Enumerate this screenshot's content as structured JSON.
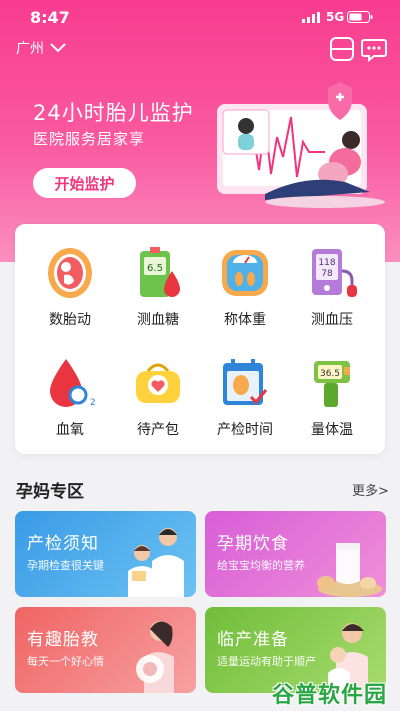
{
  "status_bar": {
    "time": "8:47",
    "network": "5G"
  },
  "location": {
    "city": "广州"
  },
  "banner": {
    "title": "24小时胎儿监护",
    "subtitle": "医院服务居家享",
    "button_label": "开始监护"
  },
  "services": [
    {
      "label": "数胎动",
      "icon": "fetus-icon"
    },
    {
      "label": "测血糖",
      "icon": "glucose-meter-icon"
    },
    {
      "label": "称体重",
      "icon": "scale-icon"
    },
    {
      "label": "测血压",
      "icon": "blood-pressure-icon"
    },
    {
      "label": "血氧",
      "icon": "blood-oxygen-icon"
    },
    {
      "label": "待产包",
      "icon": "maternity-bag-icon"
    },
    {
      "label": "产检时间",
      "icon": "calendar-icon"
    },
    {
      "label": "量体温",
      "icon": "thermometer-icon"
    }
  ],
  "section": {
    "title": "孕妈专区",
    "more": "更多>"
  },
  "tiles": [
    {
      "title": "产检须知",
      "subtitle": "孕期检查很关键",
      "color": "#4aa8e8"
    },
    {
      "title": "孕期饮食",
      "subtitle": "给宝宝均衡的营养",
      "color": "#e36fd6"
    },
    {
      "title": "有趣胎教",
      "subtitle": "每天一个好心情",
      "color": "#f36b6b"
    },
    {
      "title": "临产准备",
      "subtitle": "适量运动有助于顺产",
      "color": "#7cc34a"
    }
  ],
  "watermark": "谷普软件园",
  "colors": {
    "brand": "#f83c8f",
    "button_text": "#f0357d"
  }
}
